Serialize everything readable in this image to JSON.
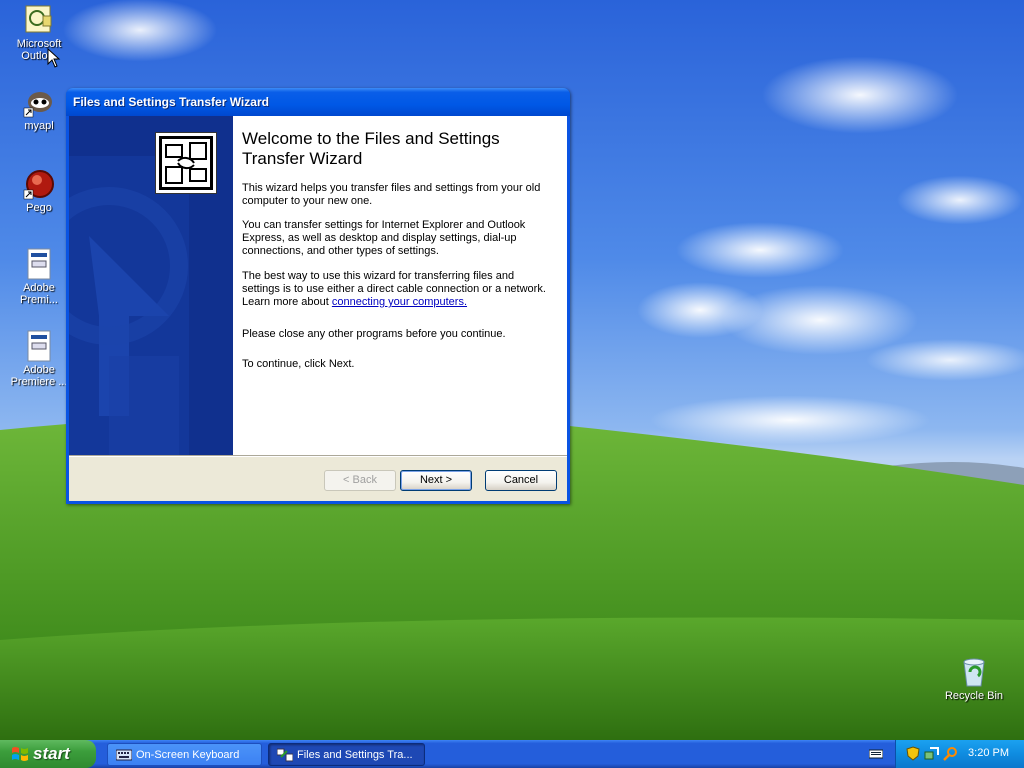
{
  "desktop": {
    "icons": [
      {
        "label": "Microsoft Outlook",
        "display": "Microsoft\nOutlo..."
      },
      {
        "label": "myapl"
      },
      {
        "label": "Pego"
      },
      {
        "label": "Adobe Premi...",
        "display": "Adobe\nPremi..."
      },
      {
        "label": "Adobe Premiere ...",
        "display": "Adobe\nPremiere ..."
      }
    ],
    "recycle_bin": "Recycle Bin"
  },
  "wizard": {
    "title": "Files and Settings Transfer Wizard",
    "heading": "Welcome to the Files and Settings Transfer Wizard",
    "p1": "This wizard helps you transfer files and settings from your old computer to your new one.",
    "p2": "You can transfer settings for Internet Explorer and Outlook Express, as well as desktop and display settings, dial-up connections, and other types of settings.",
    "p3_pre": "The best way to use this wizard for transferring files and settings is to use either a direct cable connection or a network. Learn more about ",
    "p3_link": "connecting your computers.",
    "p4": "Please close any other programs before you continue.",
    "p5": "To continue, click Next.",
    "back_label": "< Back",
    "next_label": "Next >",
    "cancel_label": "Cancel"
  },
  "taskbar": {
    "start_label": "start",
    "tasks": [
      {
        "label": "On-Screen Keyboard",
        "icon": "keyboard-icon",
        "active": false
      },
      {
        "label": "Files and Settings Tra...",
        "icon": "wizard-icon",
        "active": true
      }
    ],
    "clock": "3:20 PM"
  }
}
